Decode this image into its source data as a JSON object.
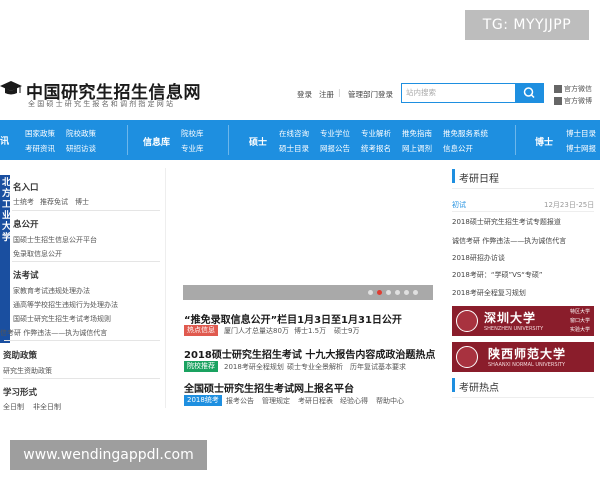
{
  "watermark_top": "TG: MYYJJPP",
  "watermark_bottom": "www.wendingappdl.com",
  "header": {
    "site_title": "中国研究生招生信息网",
    "site_subtitle": "全国硕士研究生报名和调剂指定网站",
    "links": [
      "登录",
      "注册",
      "管理部门登录"
    ],
    "search_placeholder": "站内搜索",
    "qr_links": [
      "官方微信",
      "官方微博"
    ]
  },
  "nav": {
    "left_cut": "讯",
    "col1": [
      "国家政策",
      "院校政策",
      "考研资讯",
      "研招访谈"
    ],
    "cat_library": "信息库",
    "col_library": [
      "院校库",
      "专业库"
    ],
    "cat_master": "硕士",
    "col_master": [
      "在线咨询",
      "专业学位",
      "专业解析",
      "推免指南",
      "推免服务系统",
      "硕士目录",
      "网报公告",
      "统考报名",
      "网上调剂",
      "信息公开"
    ],
    "cat_phd": "博士",
    "col_phd": [
      "博士目录",
      "博士网报"
    ]
  },
  "left": {
    "s1_title": "名入口",
    "s1_links": [
      "士统考",
      "推荐免试",
      "博士"
    ],
    "s2_title": "息公开",
    "s2_links": [
      "国硕士生招生信息公开平台",
      "免录取信息公开"
    ],
    "s3_title": "法考试",
    "s3_links": [
      "家教育考试违规处理办法",
      "通高等学校招生违规行为处理办法",
      "国硕士研究生招生考试考场规则",
      "信考研 作弊违法——执为诚信代言"
    ],
    "s4_title": "资助政策",
    "s4_links": [
      "研究生资助政策"
    ],
    "s5_title": "学习形式",
    "s5_links": [
      "全日制",
      "非全日制"
    ],
    "strip_text": "北方工业大学"
  },
  "carousel": {
    "active_dot": 2,
    "dot_count": 6
  },
  "news": [
    {
      "title": "“推免录取信息公开”栏目1月3日至1月31日公开",
      "badge": "热点信息",
      "badge_color": "#e05a4f",
      "sub": [
        "厦门人才总量达80万",
        "博士1.5万",
        "硕士9万"
      ]
    },
    {
      "title": "2018硕士研究生招生考试 十九大报告内容成政治题热点",
      "badge": "院校推荐",
      "badge_color": "#1aa260",
      "sub": [
        "2018考研全程规划",
        "硕士专业全景解析",
        "历年复试基本要求"
      ]
    },
    {
      "title": "全国硕士研究生招生考试网上报名平台",
      "badge": "2018统考",
      "badge_color": "#1e8fe0",
      "sub": [
        "报考公告",
        "管理规定",
        "考研日程表",
        "经验心得",
        "帮助中心"
      ]
    }
  ],
  "right": {
    "schedule_title": "考研日程",
    "schedule_first_label": "初试",
    "schedule_first_date": "12月23日-25日",
    "schedule_items": [
      "2018硕士研究生招生考试专题报道",
      "诚信考研 作弊违法——执为诚信代言",
      "2018研招办访谈",
      "2018考研：“学硕”VS“专硕”",
      "2018考研全程复习规划"
    ],
    "uni1": "深圳大学",
    "uni1_en": "SHENZHEN UNIVERSITY",
    "uni1_tag": [
      "特区大学",
      "窗口大学",
      "实验大学"
    ],
    "uni2": "陕西师范大学",
    "uni2_en": "SHAANXI NORMAL UNIVERSITY",
    "hot_title": "考研热点",
    "colors": {
      "brand_blue": "#1e8fe0",
      "uni_red": "#8a1d2b"
    }
  }
}
